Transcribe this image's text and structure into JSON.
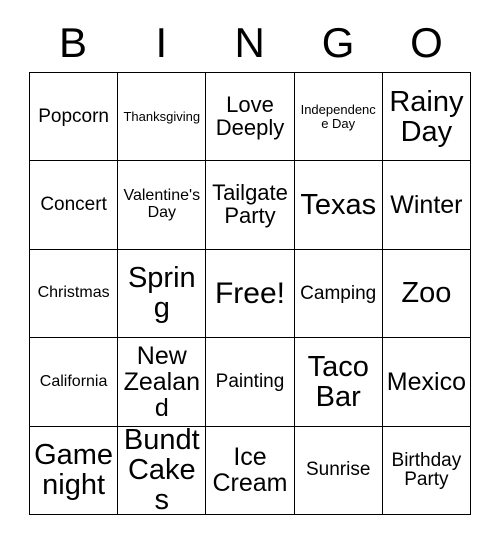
{
  "card": {
    "title": "Bingo Card",
    "header_letters": [
      "B",
      "I",
      "N",
      "G",
      "O"
    ],
    "grid_size": "5x5",
    "free_space": "Free!",
    "colors": {
      "background": "#ffffff",
      "text": "#000000",
      "border": "#000000"
    },
    "rows": [
      [
        {
          "text": "Popcorn",
          "size": "md"
        },
        {
          "text": "Thanksgiving",
          "size": "xs"
        },
        {
          "text": "Love Deeply",
          "size": "lg"
        },
        {
          "text": "Independence Day",
          "size": "xs"
        },
        {
          "text": "Rainy Day",
          "size": "xxl"
        }
      ],
      [
        {
          "text": "Concert",
          "size": "md"
        },
        {
          "text": "Valentine's Day",
          "size": "sm"
        },
        {
          "text": "Tailgate Party",
          "size": "lg"
        },
        {
          "text": "Texas",
          "size": "xxl"
        },
        {
          "text": "Winter",
          "size": "xl"
        }
      ],
      [
        {
          "text": "Christmas",
          "size": "sm"
        },
        {
          "text": "Spring",
          "size": "xxl"
        },
        {
          "text": "Free!",
          "size": "free"
        },
        {
          "text": "Camping",
          "size": "md"
        },
        {
          "text": "Zoo",
          "size": "xxl"
        }
      ],
      [
        {
          "text": "California",
          "size": "sm"
        },
        {
          "text": "New Zealand",
          "size": "xl"
        },
        {
          "text": "Painting",
          "size": "md"
        },
        {
          "text": "Taco Bar",
          "size": "xxl"
        },
        {
          "text": "Mexico",
          "size": "xl"
        }
      ],
      [
        {
          "text": "Game night",
          "size": "xxl"
        },
        {
          "text": "Bundt Cakes",
          "size": "xxl"
        },
        {
          "text": "Ice Cream",
          "size": "xl"
        },
        {
          "text": "Sunrise",
          "size": "md"
        },
        {
          "text": "Birthday Party",
          "size": "md"
        }
      ]
    ]
  }
}
